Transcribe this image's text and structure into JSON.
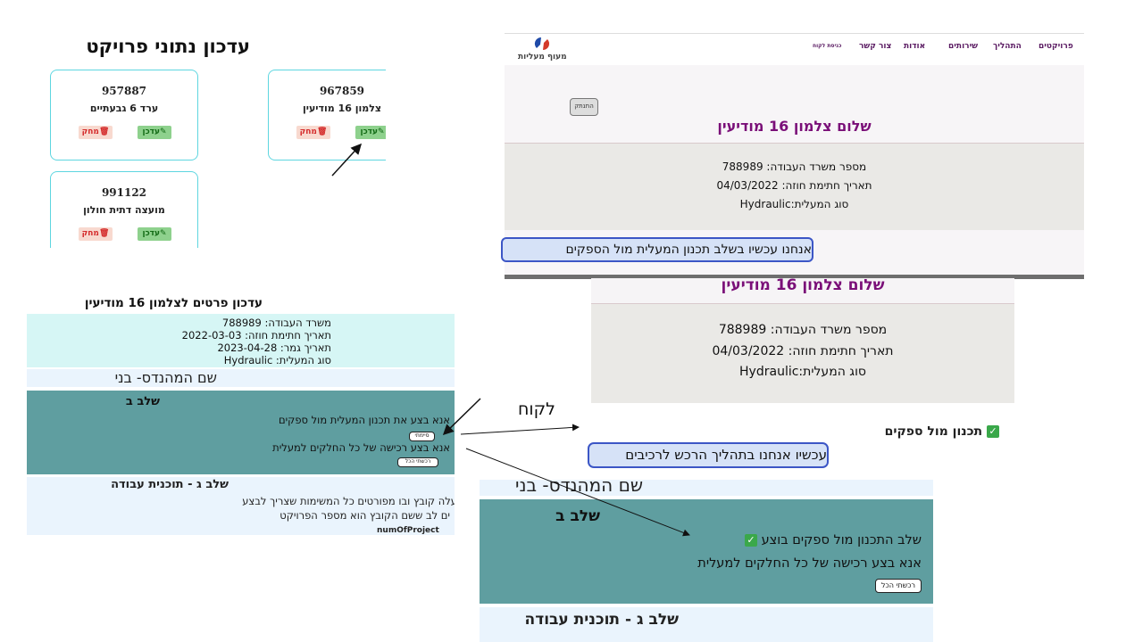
{
  "panel_projects": {
    "title": "עדכון נתוני פרויקט",
    "delete_label": "מחק",
    "update_label": "עדכן",
    "cards": [
      {
        "number": "957887",
        "name": "ערד 6 גבעתיים"
      },
      {
        "number": "967859",
        "name": "צלמון 16 מודיעין"
      },
      {
        "number": "991122",
        "name": "מועצה דתית חולון"
      }
    ]
  },
  "site": {
    "logo_text": "מעוף מעליות",
    "nav": [
      "פרויקטים",
      "התהליך",
      "שירותים",
      "אודות",
      "צור קשר",
      "כניסת לקוח"
    ],
    "logout_label": "התנתק",
    "greeting": "שלום צלמון 16 מודיעין",
    "labor_ministry": "מספר משרד העבודה: 788989",
    "contract_date": "תאריך חתימת חוזה: 04/03/2022",
    "elevator_type": "סוג המעלית:Hydraulic",
    "status": "אנחנו עכשיו בשלב תכנון המעלית מול הספקים"
  },
  "zoom": {
    "greeting": "שלום צלמון 16 מודיעין",
    "labor_ministry": "מספר משרד העבודה: 788989",
    "contract_date": "תאריך חתימת חוזה: 04/03/2022",
    "elevator_type": "סוג המעלית:Hydraulic",
    "completed_stage": "תכנון מול ספקים",
    "status": "עכשיו אנחנו בתהליך הרכש לרכיבים"
  },
  "admin": {
    "title": "עדכון פרטים לצלמון 16 מודיעין",
    "labor_ministry": "משרד העבודה: 788989",
    "contract_date": "תאריך חתימת חוזה: 2022-03-03",
    "end_date": "תאריך גמר: 2023-04-28",
    "elevator_type": "סוג המעלית: Hydraulic",
    "engineer": "שם המהנדס- בני",
    "stage_b_title": "שלב ב",
    "task1": "אנא בצע את תכנון המעלית מול ספקים",
    "finished_label": "סיימתי",
    "task2": "אנא בצע רכישה של כל החלקים למעלית",
    "bought_all_label": "רכשתי הכל",
    "stage_c_title": "שלב ג - תוכנית עבודה",
    "stage_c_line1": "עלה קובץ ובו מפורטים כל המשימות שצריך לבצע",
    "stage_c_line2": "ים לב ששם הקובץ הוא מספר הפרויקט",
    "stage_c_line3": "numOfProject"
  },
  "annotation": {
    "customer_label": "לקוח"
  },
  "result": {
    "engineer": "שם המהנדס- בני",
    "stage_b_title": "שלב ב",
    "completed": "שלב התכנון מול ספקים בוצע",
    "task2": "אנא בצע רכישה של כל החלקים למעלית",
    "bought_all_label": "רכשתי הכל",
    "stage_c_title": "שלב ג - תוכנית עבודה"
  },
  "colors": {
    "brand_purple": "#7a0f78",
    "card_border": "#5ed6e0",
    "stage_teal": "#5f9ea0",
    "check_green": "#3aa84a"
  }
}
